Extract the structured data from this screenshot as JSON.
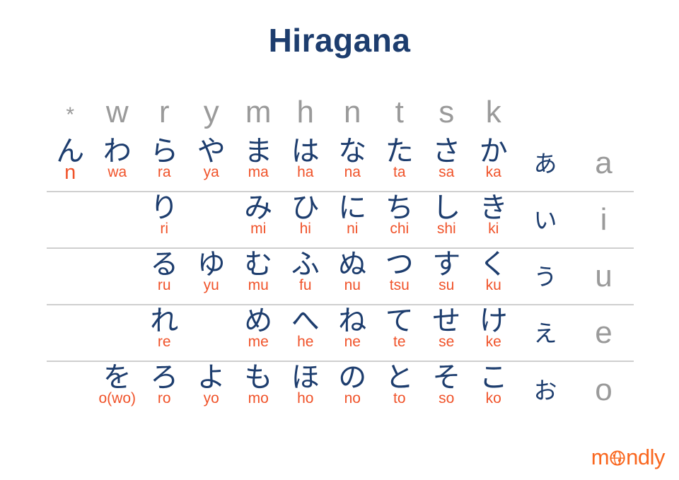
{
  "title": "Hiragana",
  "colors": {
    "kana": "#1d3d6e",
    "romaji": "#f0532a",
    "header_gray": "#9a9a9a",
    "rule": "#cfcfcf",
    "logo_orange": "#f9671f",
    "background": "#ffffff"
  },
  "chart_data": {
    "type": "table",
    "title": "Hiragana",
    "description": "Hiragana syllabary chart arranged right-to-left by consonant column and top-to-bottom by vowel row.",
    "consonant_headers": [
      "*",
      "w",
      "r",
      "y",
      "m",
      "h",
      "n",
      "t",
      "s",
      "k"
    ],
    "vowel_rows": [
      "a",
      "i",
      "u",
      "e",
      "o"
    ],
    "vowel_kana": [
      "あ",
      "い",
      "う",
      "え",
      "お"
    ],
    "vowel_letters": [
      "a",
      "i",
      "u",
      "e",
      "o"
    ],
    "rows": [
      {
        "vowel": "a",
        "vowel_kana": "あ",
        "vowel_letter": "a",
        "cells": [
          {
            "kana": "ん",
            "romaji": "n",
            "emphasis": "large"
          },
          {
            "kana": "わ",
            "romaji": "wa"
          },
          {
            "kana": "ら",
            "romaji": "ra"
          },
          {
            "kana": "や",
            "romaji": "ya"
          },
          {
            "kana": "ま",
            "romaji": "ma"
          },
          {
            "kana": "は",
            "romaji": "ha"
          },
          {
            "kana": "な",
            "romaji": "na"
          },
          {
            "kana": "た",
            "romaji": "ta"
          },
          {
            "kana": "さ",
            "romaji": "sa"
          },
          {
            "kana": "か",
            "romaji": "ka"
          }
        ]
      },
      {
        "vowel": "i",
        "vowel_kana": "い",
        "vowel_letter": "i",
        "cells": [
          {
            "kana": "",
            "romaji": ""
          },
          {
            "kana": "",
            "romaji": ""
          },
          {
            "kana": "り",
            "romaji": "ri"
          },
          {
            "kana": "",
            "romaji": ""
          },
          {
            "kana": "み",
            "romaji": "mi"
          },
          {
            "kana": "ひ",
            "romaji": "hi"
          },
          {
            "kana": "に",
            "romaji": "ni"
          },
          {
            "kana": "ち",
            "romaji": "chi"
          },
          {
            "kana": "し",
            "romaji": "shi"
          },
          {
            "kana": "き",
            "romaji": "ki"
          }
        ]
      },
      {
        "vowel": "u",
        "vowel_kana": "う",
        "vowel_letter": "u",
        "cells": [
          {
            "kana": "",
            "romaji": ""
          },
          {
            "kana": "",
            "romaji": ""
          },
          {
            "kana": "る",
            "romaji": "ru"
          },
          {
            "kana": "ゆ",
            "romaji": "yu"
          },
          {
            "kana": "む",
            "romaji": "mu"
          },
          {
            "kana": "ふ",
            "romaji": "fu"
          },
          {
            "kana": "ぬ",
            "romaji": "nu"
          },
          {
            "kana": "つ",
            "romaji": "tsu"
          },
          {
            "kana": "す",
            "romaji": "su"
          },
          {
            "kana": "く",
            "romaji": "ku"
          }
        ]
      },
      {
        "vowel": "e",
        "vowel_kana": "え",
        "vowel_letter": "e",
        "cells": [
          {
            "kana": "",
            "romaji": ""
          },
          {
            "kana": "",
            "romaji": ""
          },
          {
            "kana": "れ",
            "romaji": "re"
          },
          {
            "kana": "",
            "romaji": ""
          },
          {
            "kana": "め",
            "romaji": "me"
          },
          {
            "kana": "へ",
            "romaji": "he"
          },
          {
            "kana": "ね",
            "romaji": "ne"
          },
          {
            "kana": "て",
            "romaji": "te"
          },
          {
            "kana": "せ",
            "romaji": "se"
          },
          {
            "kana": "け",
            "romaji": "ke"
          }
        ]
      },
      {
        "vowel": "o",
        "vowel_kana": "お",
        "vowel_letter": "o",
        "cells": [
          {
            "kana": "",
            "romaji": ""
          },
          {
            "kana": "を",
            "romaji": "o(wo)",
            "emphasis": "wide"
          },
          {
            "kana": "ろ",
            "romaji": "ro"
          },
          {
            "kana": "よ",
            "romaji": "yo"
          },
          {
            "kana": "も",
            "romaji": "mo"
          },
          {
            "kana": "ほ",
            "romaji": "ho"
          },
          {
            "kana": "の",
            "romaji": "no"
          },
          {
            "kana": "と",
            "romaji": "to"
          },
          {
            "kana": "そ",
            "romaji": "so"
          },
          {
            "kana": "こ",
            "romaji": "ko"
          }
        ]
      }
    ]
  },
  "logo": {
    "text_before": "m",
    "globe_icon": "globe-icon",
    "text_after": "ndly",
    "full_text": "mondly"
  }
}
